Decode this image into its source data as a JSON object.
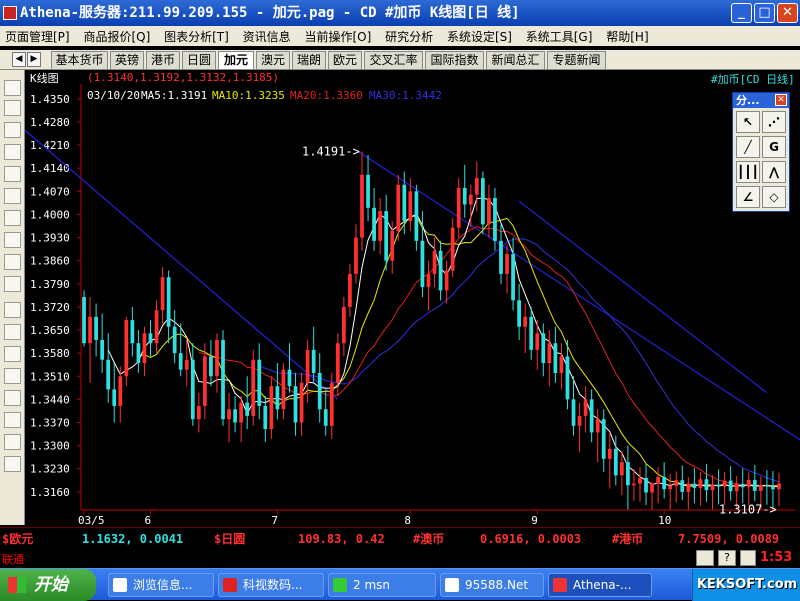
{
  "window": {
    "title": "Athena-服务器:211.99.209.155  - 加元.pag - CD #加币 K线图[日 线]",
    "minimize": "_",
    "maximize": "□",
    "close": "✕"
  },
  "menu": [
    "页面管理[P]",
    "商品报价[Q]",
    "图表分析[T]",
    "资讯信息",
    "当前操作[O]",
    "研究分析",
    "系统设定[S]",
    "系统工具[G]",
    "帮助[H]"
  ],
  "tabs": [
    "基本货币",
    "英镑",
    "港币",
    "日圆",
    "加元",
    "澳元",
    "瑞朗",
    "欧元",
    "交叉汇率",
    "国际指数",
    "新闻总汇",
    "专题新闻"
  ],
  "active_tab": "加元",
  "chart_header": {
    "label": "K线图",
    "ohlc_text": "(1.3140,1.3192,1.3132,1.3185)",
    "date": "03/10/20",
    "ma5": "MA5:1.3191",
    "ma10": "MA10:1.3235",
    "ma20": "MA20:1.3360",
    "ma30": "MA30:1.3442",
    "symbol_title": "#加币[CD 日线]"
  },
  "colors": {
    "up": "#ff3030",
    "down": "#30e0e0",
    "ma5": "#ffffff",
    "ma10": "#e8e800",
    "ma20": "#e02020",
    "ma30": "#3030e0",
    "channel": "#2020c8",
    "axis": "#c00000"
  },
  "drawing_palette": {
    "title": "分...",
    "close": "✕",
    "g_button": "G"
  },
  "quote_bar": [
    {
      "name": "$欧元",
      "value": "1.1632, 0.0041"
    },
    {
      "name": "$日圆",
      "value": "109.83, 0.42"
    },
    {
      "name": "#澳币",
      "value": "0.6916, 0.0003"
    },
    {
      "name": "#港币",
      "value": "7.7509, 0.0089"
    }
  ],
  "status_text": "联通",
  "taskbar": {
    "start": "开始",
    "tasks": [
      "浏览信息...",
      "科视数码...",
      "2 msn",
      "95588.Net",
      "Athena-..."
    ],
    "tray_time": "1:53",
    "tray_brand": "KEKSOFT.com"
  },
  "chart_data": {
    "type": "candlestick",
    "y_ticks": [
      1.316,
      1.323,
      1.33,
      1.337,
      1.344,
      1.351,
      1.358,
      1.365,
      1.372,
      1.379,
      1.386,
      1.393,
      1.4,
      1.407,
      1.414,
      1.421,
      1.428,
      1.435
    ],
    "y_tick_labels": [
      "1.3160",
      "1.3230",
      "1.3300",
      "1.3370",
      "1.3440",
      "1.3510",
      "1.3580",
      "1.3650",
      "1.3720",
      "1.3790",
      "1.3860",
      "1.3930",
      "1.4000",
      "1.4070",
      "1.4140",
      "1.4210",
      "1.4280",
      "1.4350"
    ],
    "ylim": [
      1.3105,
      1.4395
    ],
    "x_labels": [
      {
        "label": "03/5",
        "index": 0
      },
      {
        "label": "6",
        "index": 11
      },
      {
        "label": "7",
        "index": 32
      },
      {
        "label": "8",
        "index": 54
      },
      {
        "label": "9",
        "index": 75
      },
      {
        "label": "10",
        "index": 96
      }
    ],
    "annotations": [
      {
        "text": "1.4191->",
        "index": 46,
        "value": 1.4191
      },
      {
        "text": "1.3107->",
        "index": 115,
        "value": 1.3107
      }
    ],
    "channel_lines": [
      {
        "from": [
          -12,
          1.429
        ],
        "to": [
          42,
          1.344
        ]
      },
      {
        "from": [
          45,
          1.4195
        ],
        "to": [
          130,
          1.318
        ]
      },
      {
        "from": [
          72,
          1.404
        ],
        "to": [
          113,
          1.346
        ]
      }
    ],
    "ohlc": [
      [
        1.375,
        1.377,
        1.36,
        1.361
      ],
      [
        1.361,
        1.375,
        1.349,
        1.369
      ],
      [
        1.369,
        1.373,
        1.357,
        1.362
      ],
      [
        1.362,
        1.37,
        1.352,
        1.356
      ],
      [
        1.356,
        1.364,
        1.343,
        1.347
      ],
      [
        1.347,
        1.355,
        1.337,
        1.342
      ],
      [
        1.342,
        1.354,
        1.337,
        1.351
      ],
      [
        1.351,
        1.369,
        1.348,
        1.368
      ],
      [
        1.368,
        1.372,
        1.357,
        1.361
      ],
      [
        1.361,
        1.365,
        1.352,
        1.355
      ],
      [
        1.355,
        1.366,
        1.351,
        1.364
      ],
      [
        1.364,
        1.368,
        1.357,
        1.361
      ],
      [
        1.361,
        1.374,
        1.358,
        1.371
      ],
      [
        1.371,
        1.384,
        1.367,
        1.381
      ],
      [
        1.381,
        1.383,
        1.361,
        1.366
      ],
      [
        1.366,
        1.371,
        1.355,
        1.358
      ],
      [
        1.358,
        1.367,
        1.351,
        1.353
      ],
      [
        1.353,
        1.362,
        1.348,
        1.356
      ],
      [
        1.356,
        1.361,
        1.336,
        1.338
      ],
      [
        1.338,
        1.346,
        1.334,
        1.342
      ],
      [
        1.342,
        1.361,
        1.338,
        1.357
      ],
      [
        1.357,
        1.362,
        1.348,
        1.351
      ],
      [
        1.351,
        1.364,
        1.346,
        1.362
      ],
      [
        1.362,
        1.365,
        1.336,
        1.338
      ],
      [
        1.338,
        1.346,
        1.331,
        1.341
      ],
      [
        1.341,
        1.345,
        1.334,
        1.337
      ],
      [
        1.337,
        1.345,
        1.331,
        1.343
      ],
      [
        1.343,
        1.351,
        1.335,
        1.339
      ],
      [
        1.339,
        1.359,
        1.336,
        1.356
      ],
      [
        1.356,
        1.361,
        1.338,
        1.342
      ],
      [
        1.342,
        1.345,
        1.331,
        1.335
      ],
      [
        1.335,
        1.351,
        1.332,
        1.348
      ],
      [
        1.348,
        1.355,
        1.338,
        1.341
      ],
      [
        1.341,
        1.355,
        1.338,
        1.353
      ],
      [
        1.353,
        1.361,
        1.346,
        1.348
      ],
      [
        1.348,
        1.352,
        1.333,
        1.337
      ],
      [
        1.337,
        1.352,
        1.333,
        1.349
      ],
      [
        1.349,
        1.362,
        1.343,
        1.359
      ],
      [
        1.359,
        1.366,
        1.349,
        1.352
      ],
      [
        1.352,
        1.358,
        1.337,
        1.341
      ],
      [
        1.341,
        1.347,
        1.333,
        1.336
      ],
      [
        1.336,
        1.352,
        1.332,
        1.349
      ],
      [
        1.349,
        1.364,
        1.345,
        1.361
      ],
      [
        1.361,
        1.375,
        1.357,
        1.372
      ],
      [
        1.372,
        1.385,
        1.369,
        1.382
      ],
      [
        1.382,
        1.397,
        1.379,
        1.393
      ],
      [
        1.393,
        1.4191,
        1.389,
        1.412
      ],
      [
        1.412,
        1.418,
        1.398,
        1.402
      ],
      [
        1.402,
        1.408,
        1.389,
        1.392
      ],
      [
        1.392,
        1.405,
        1.388,
        1.401
      ],
      [
        1.401,
        1.406,
        1.383,
        1.386
      ],
      [
        1.386,
        1.398,
        1.382,
        1.395
      ],
      [
        1.395,
        1.412,
        1.392,
        1.409
      ],
      [
        1.409,
        1.413,
        1.394,
        1.398
      ],
      [
        1.398,
        1.411,
        1.395,
        1.407
      ],
      [
        1.407,
        1.409,
        1.389,
        1.392
      ],
      [
        1.392,
        1.401,
        1.375,
        1.378
      ],
      [
        1.378,
        1.386,
        1.371,
        1.382
      ],
      [
        1.382,
        1.393,
        1.378,
        1.389
      ],
      [
        1.389,
        1.392,
        1.374,
        1.377
      ],
      [
        1.377,
        1.386,
        1.373,
        1.383
      ],
      [
        1.383,
        1.399,
        1.381,
        1.396
      ],
      [
        1.396,
        1.411,
        1.393,
        1.408
      ],
      [
        1.408,
        1.415,
        1.399,
        1.403
      ],
      [
        1.403,
        1.409,
        1.396,
        1.406
      ],
      [
        1.406,
        1.416,
        1.401,
        1.411
      ],
      [
        1.411,
        1.413,
        1.394,
        1.397
      ],
      [
        1.397,
        1.409,
        1.393,
        1.405
      ],
      [
        1.405,
        1.408,
        1.389,
        1.392
      ],
      [
        1.392,
        1.397,
        1.379,
        1.382
      ],
      [
        1.382,
        1.391,
        1.376,
        1.388
      ],
      [
        1.388,
        1.393,
        1.371,
        1.374
      ],
      [
        1.374,
        1.379,
        1.362,
        1.366
      ],
      [
        1.366,
        1.373,
        1.358,
        1.369
      ],
      [
        1.369,
        1.372,
        1.356,
        1.359
      ],
      [
        1.359,
        1.368,
        1.353,
        1.364
      ],
      [
        1.364,
        1.367,
        1.351,
        1.355
      ],
      [
        1.355,
        1.365,
        1.348,
        1.361
      ],
      [
        1.361,
        1.366,
        1.349,
        1.352
      ],
      [
        1.352,
        1.361,
        1.347,
        1.357
      ],
      [
        1.357,
        1.362,
        1.341,
        1.344
      ],
      [
        1.344,
        1.351,
        1.333,
        1.336
      ],
      [
        1.336,
        1.343,
        1.328,
        1.339
      ],
      [
        1.339,
        1.348,
        1.334,
        1.344
      ],
      [
        1.344,
        1.347,
        1.331,
        1.334
      ],
      [
        1.334,
        1.341,
        1.325,
        1.338
      ],
      [
        1.338,
        1.341,
        1.322,
        1.326
      ],
      [
        1.326,
        1.334,
        1.317,
        1.329
      ],
      [
        1.329,
        1.333,
        1.318,
        1.321
      ],
      [
        1.321,
        1.328,
        1.315,
        1.325
      ],
      [
        1.325,
        1.33,
        1.3107,
        1.318
      ],
      [
        1.318,
        1.323,
        1.3132,
        1.3185
      ],
      [
        1.3185,
        1.3235,
        1.313,
        1.3202
      ],
      [
        1.3202,
        1.3245,
        1.312,
        1.3158
      ],
      [
        1.3158,
        1.319,
        1.3107,
        1.3185
      ],
      [
        1.3185,
        1.3235,
        1.3125,
        1.3205
      ],
      [
        1.3205,
        1.325,
        1.314,
        1.3168
      ],
      [
        1.3168,
        1.3215,
        1.3107,
        1.3178
      ],
      [
        1.3178,
        1.3222,
        1.3128,
        1.3195
      ],
      [
        1.3195,
        1.324,
        1.3135,
        1.316
      ],
      [
        1.316,
        1.3205,
        1.3107,
        1.3185
      ],
      [
        1.3185,
        1.3232,
        1.3125,
        1.3172
      ],
      [
        1.3172,
        1.322,
        1.3118,
        1.3198
      ],
      [
        1.3198,
        1.3245,
        1.313,
        1.3165
      ],
      [
        1.3165,
        1.321,
        1.3107,
        1.3182
      ],
      [
        1.3182,
        1.3228,
        1.3122,
        1.3176
      ],
      [
        1.3176,
        1.322,
        1.312,
        1.3194
      ],
      [
        1.3194,
        1.3238,
        1.3134,
        1.3162
      ],
      [
        1.3162,
        1.3208,
        1.3107,
        1.3184
      ],
      [
        1.3184,
        1.3231,
        1.3126,
        1.3174
      ],
      [
        1.3174,
        1.3219,
        1.3119,
        1.3196
      ],
      [
        1.3196,
        1.3241,
        1.3132,
        1.3163
      ],
      [
        1.3163,
        1.3207,
        1.3107,
        1.3181
      ],
      [
        1.3181,
        1.3226,
        1.3121,
        1.3178
      ],
      [
        1.3178,
        1.3223,
        1.3107,
        1.3168
      ],
      [
        1.3168,
        1.3218,
        1.3117,
        1.3185
      ]
    ]
  }
}
